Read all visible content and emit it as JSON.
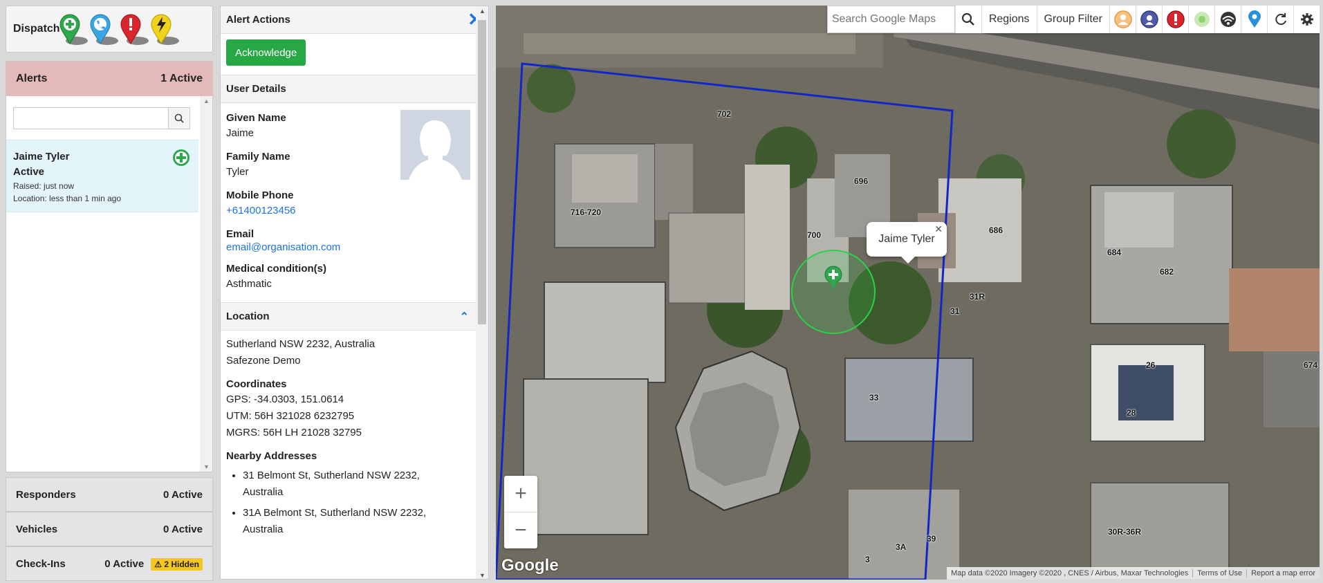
{
  "dispatch": {
    "title": "Dispatch",
    "pins": [
      {
        "name": "medical",
        "color": "#2ea84f"
      },
      {
        "name": "phone",
        "color": "#3ba5e0"
      },
      {
        "name": "alert",
        "color": "#d9262c"
      },
      {
        "name": "lightning",
        "color": "#f0d21b"
      }
    ]
  },
  "alerts": {
    "title": "Alerts",
    "count": "1 Active",
    "search_placeholder": "",
    "items": [
      {
        "name": "Jaime Tyler",
        "status": "Active",
        "raised": "Raised: just now",
        "location": "Location: less than 1 min ago"
      }
    ]
  },
  "summaries": {
    "responders": {
      "label": "Responders",
      "count": "0 Active"
    },
    "vehicles": {
      "label": "Vehicles",
      "count": "0 Active"
    },
    "checkins": {
      "label": "Check-Ins",
      "count": "0 Active",
      "badge": "2 Hidden"
    }
  },
  "alert_actions": {
    "title": "Alert Actions",
    "acknowledge": "Acknowledge"
  },
  "user_details": {
    "title": "User Details",
    "given_name_label": "Given Name",
    "given_name": "Jaime",
    "family_name_label": "Family Name",
    "family_name": "Tyler",
    "mobile_label": "Mobile Phone",
    "mobile": "+61400123456",
    "email_label": "Email",
    "email": "email@organisation.com",
    "medical_label": "Medical condition(s)",
    "medical": "Asthmatic"
  },
  "location": {
    "title": "Location",
    "address_line1": "Sutherland NSW 2232, Australia",
    "address_line2": "Safezone Demo",
    "coords_label": "Coordinates",
    "gps": "GPS: -34.0303, 151.0614",
    "utm": "UTM: 56H 321028 6232795",
    "mgrs": "MGRS: 56H LH 21028 32795",
    "nearby_label": "Nearby Addresses",
    "nearby": [
      "31 Belmont St, Sutherland NSW 2232, Australia",
      "31A Belmont St, Sutherland NSW 2232, Australia"
    ]
  },
  "map": {
    "search_placeholder": "Search Google Maps",
    "regions": "Regions",
    "group_filter": "Group Filter",
    "popup_name": "Jaime Tyler",
    "google": "Google",
    "attribution": [
      "Map data ©2020 Imagery ©2020 , CNES / Airbus, Maxar Technologies",
      "Terms of Use",
      "Report a map error"
    ],
    "building_labels": [
      "702",
      "696",
      "686",
      "716-720",
      "700",
      "684",
      "682",
      "31R",
      "31",
      "26",
      "28",
      "674",
      "33",
      "39",
      "3A",
      "3",
      "30R-36R"
    ],
    "toolbar_icons": [
      "responder-filter-icon",
      "guard-filter-icon",
      "alert-filter-icon",
      "geofence-filter-icon",
      "satellite-toggle-icon",
      "location-pin-icon",
      "refresh-icon",
      "settings-icon"
    ]
  }
}
